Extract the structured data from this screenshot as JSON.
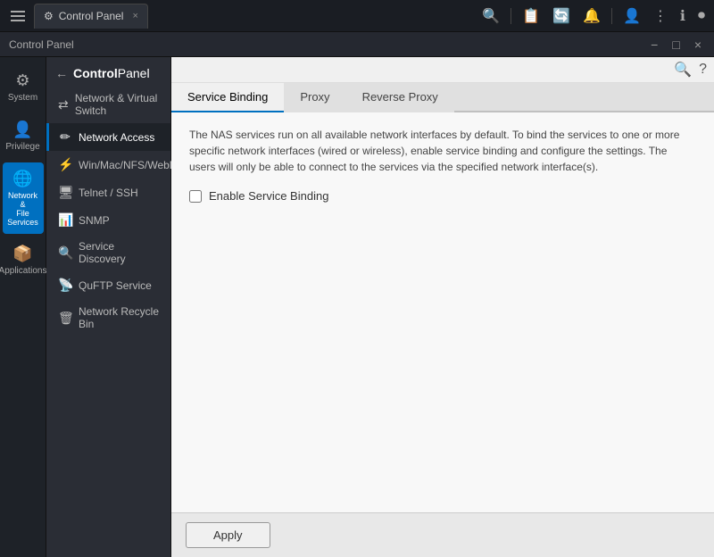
{
  "taskbar": {
    "menu_icon_label": "Menu",
    "tab_icon": "⚙",
    "tab_label": "Control Panel",
    "tab_close": "×",
    "icons_right": [
      "🔍",
      "|",
      "📋",
      "🔔",
      "|",
      "👤",
      "⋮",
      "ℹ",
      "🔘"
    ]
  },
  "window": {
    "title": "Control Panel",
    "controls": [
      "−",
      "□",
      "×"
    ]
  },
  "sidebar_icons": [
    {
      "id": "system",
      "icon": "⚙",
      "label": "System"
    },
    {
      "id": "privilege",
      "icon": "👤",
      "label": "Privilege"
    },
    {
      "id": "network-file-services",
      "icon": "🌐",
      "label": "Network &\nFile Services",
      "active": true
    },
    {
      "id": "applications",
      "icon": "📦",
      "label": "Applications"
    }
  ],
  "nav": {
    "back_label": "ControlPanel",
    "items": [
      {
        "id": "network-virtual-switch",
        "icon": "🔀",
        "label": "Network & Virtual Switch"
      },
      {
        "id": "network-access",
        "icon": "✏",
        "label": "Network Access",
        "active": true
      },
      {
        "id": "win-mac-nfs-webdav",
        "icon": "⚡",
        "label": "Win/Mac/NFS/WebDAV"
      },
      {
        "id": "telnet-ssh",
        "icon": "🖥",
        "label": "Telnet / SSH"
      },
      {
        "id": "snmp",
        "icon": "📊",
        "label": "SNMP"
      },
      {
        "id": "service-discovery",
        "icon": "🔍",
        "label": "Service Discovery"
      },
      {
        "id": "quftp-service",
        "icon": "📡",
        "label": "QuFTP Service"
      },
      {
        "id": "network-recycle-bin",
        "icon": "🗑",
        "label": "Network Recycle Bin"
      }
    ]
  },
  "tabs": [
    {
      "id": "service-binding",
      "label": "Service Binding",
      "active": true
    },
    {
      "id": "proxy",
      "label": "Proxy"
    },
    {
      "id": "reverse-proxy",
      "label": "Reverse Proxy"
    }
  ],
  "content": {
    "description": "The NAS services run on all available network interfaces by default. To bind the services to one or more specific network interfaces (wired or wireless), enable service binding and configure the settings. The users will only be able to connect to the services via the specified network interface(s).",
    "checkbox_label": "Enable Service Binding",
    "checkbox_checked": false
  },
  "footer": {
    "apply_label": "Apply"
  },
  "header_icons": {
    "search": "🔍",
    "help": "?"
  }
}
